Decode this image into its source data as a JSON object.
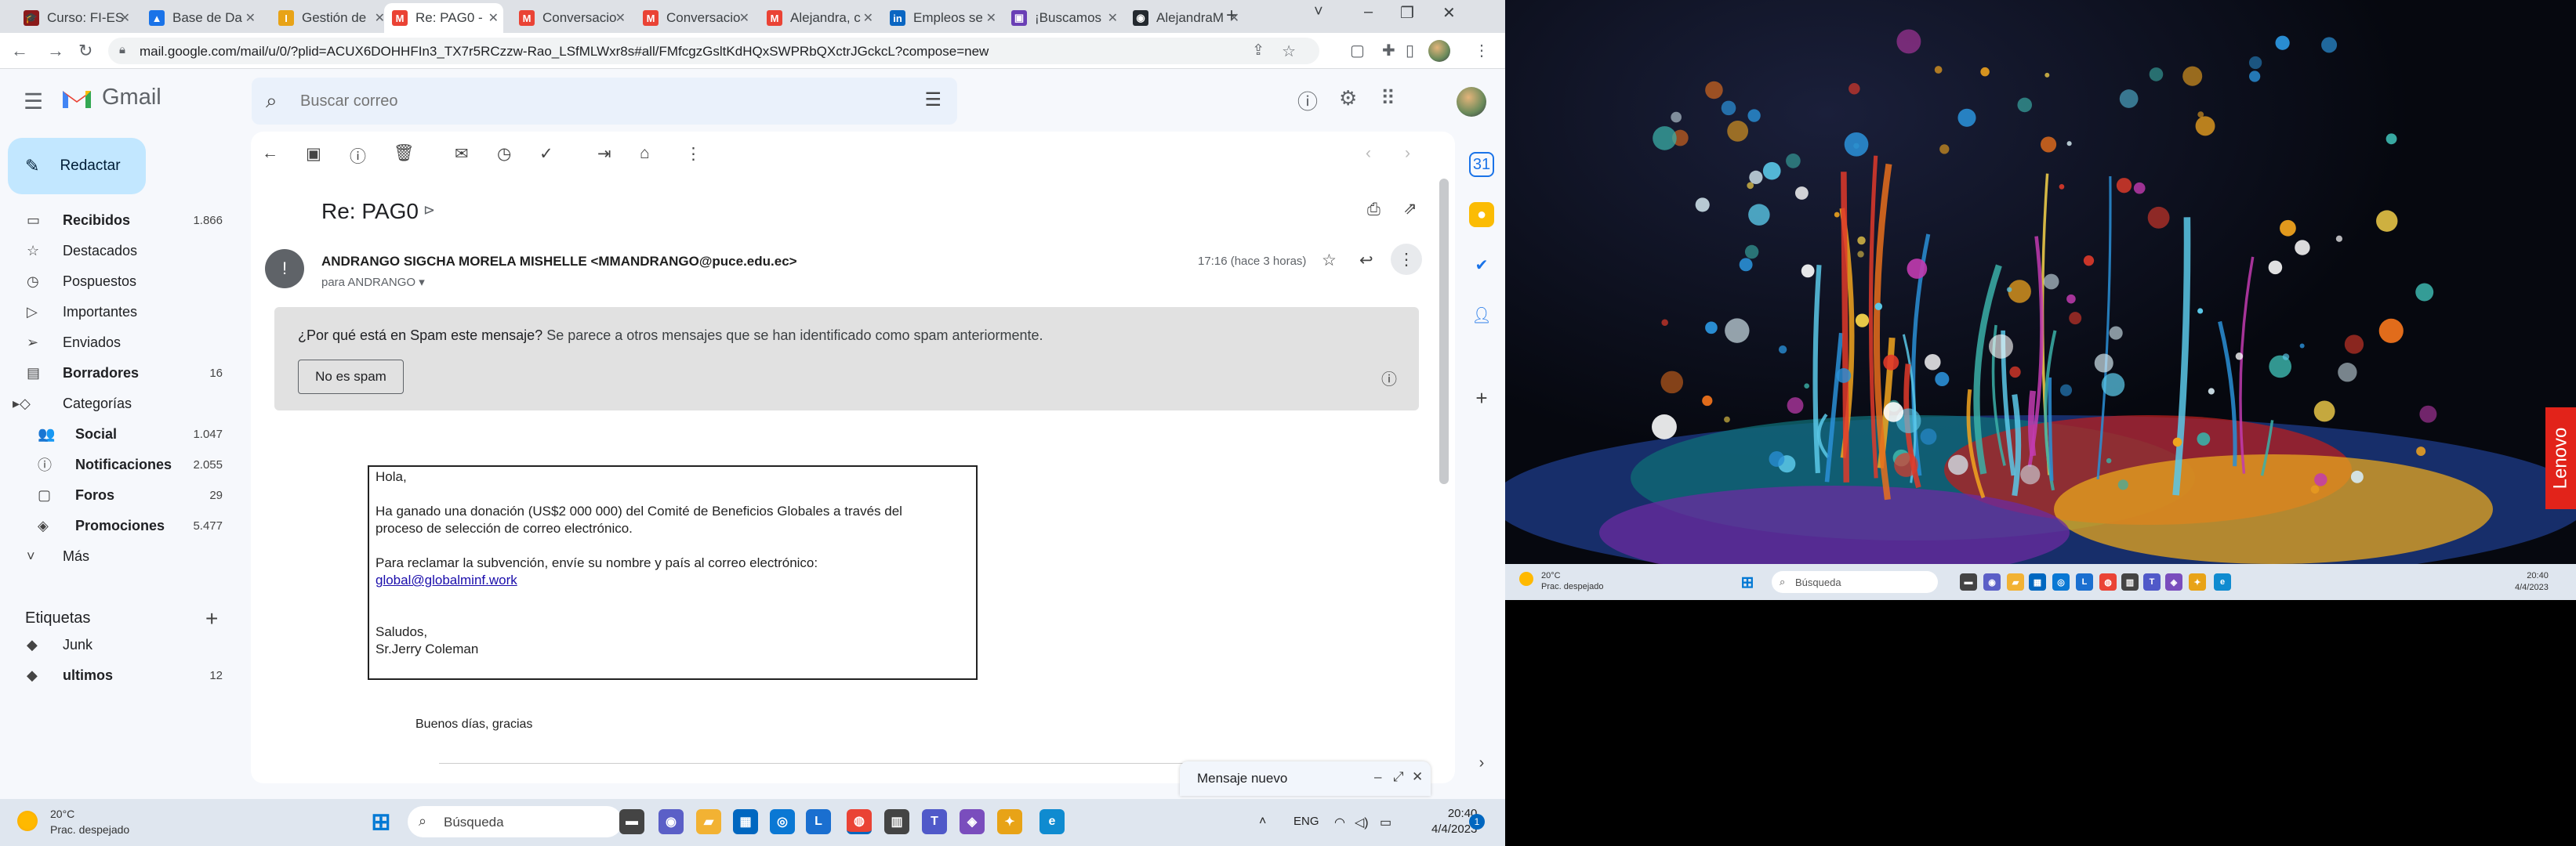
{
  "browser": {
    "tabs": [
      {
        "label": "Curso: FI-ES",
        "color": "#8b1a1a",
        "glyph": "🎓"
      },
      {
        "label": "Base de Da",
        "color": "#1a73e8",
        "glyph": "▲"
      },
      {
        "label": "Gestión de",
        "color": "#e8a317",
        "glyph": "I"
      },
      {
        "label": "Re: PAG0 -",
        "color": "#ea4335",
        "glyph": "M",
        "active": true
      },
      {
        "label": "Conversacio",
        "color": "#ea4335",
        "glyph": "M"
      },
      {
        "label": "Conversacio",
        "color": "#ea4335",
        "glyph": "M"
      },
      {
        "label": "Alejandra, c",
        "color": "#ea4335",
        "glyph": "M"
      },
      {
        "label": "Empleos se",
        "color": "#0a66c2",
        "glyph": "in"
      },
      {
        "label": "¡Buscamos",
        "color": "#6a3fb5",
        "glyph": "▣"
      },
      {
        "label": "AlejandraM",
        "color": "#24292f",
        "glyph": "◉"
      }
    ],
    "new_tab": "+",
    "url": "mail.google.com/mail/u/0/?plid=ACUX6DOHHFIn3_TX7r5RCzzw-Rao_LSfMLWxr8s#all/FMfcgzGsltKdHQxSWPRbQXctrJGckcL?compose=new"
  },
  "gmail": {
    "brand": "Gmail",
    "search_placeholder": "Buscar correo",
    "compose_label": "Redactar",
    "nav": [
      {
        "label": "Recibidos",
        "count": "1.866",
        "icon": "inbox-icon",
        "glyph": "▭",
        "bold": true
      },
      {
        "label": "Destacados",
        "count": "",
        "icon": "star-icon",
        "glyph": "☆",
        "bold": false
      },
      {
        "label": "Pospuestos",
        "count": "",
        "icon": "clock-icon",
        "glyph": "◷",
        "bold": false
      },
      {
        "label": "Importantes",
        "count": "",
        "icon": "important-icon",
        "glyph": "▷",
        "bold": false
      },
      {
        "label": "Enviados",
        "count": "",
        "icon": "send-icon",
        "glyph": "➢",
        "bold": false
      },
      {
        "label": "Borradores",
        "count": "16",
        "icon": "draft-icon",
        "glyph": "▤",
        "bold": true
      },
      {
        "label": "Categorías",
        "count": "",
        "icon": "category-icon",
        "glyph": "▸◇",
        "bold": false
      }
    ],
    "categories": [
      {
        "label": "Social",
        "count": "1.047",
        "icon": "people-icon",
        "glyph": "👥"
      },
      {
        "label": "Notificaciones",
        "count": "2.055",
        "icon": "info-icon",
        "glyph": "ⓘ"
      },
      {
        "label": "Foros",
        "count": "29",
        "icon": "forum-icon",
        "glyph": "▢"
      },
      {
        "label": "Promociones",
        "count": "5.477",
        "icon": "tag-icon",
        "glyph": "◈"
      }
    ],
    "more_label": "Más",
    "labels_heading": "Etiquetas",
    "labels": [
      {
        "label": "Junk",
        "count": "",
        "bold": false
      },
      {
        "label": "ultimos",
        "count": "12",
        "bold": true
      }
    ],
    "email": {
      "subject": "Re: PAG0",
      "sender": "ANDRANGO SIGCHA MORELA MISHELLE <MMANDRANGO@puce.edu.ec>",
      "to": "para ANDRANGO",
      "time": "17:16 (hace 3 horas)",
      "spam_question": "¿Por qué está en Spam este mensaje?",
      "spam_reason": " Se parece a otros mensajes que se han identificado como spam anteriormente.",
      "not_spam_button": "No es spam",
      "body": {
        "greeting": "Hola,",
        "line1": "Ha ganado una donación (US$2 000 000) del Comité de Beneficios Globales a través del",
        "line2": "proceso de selección de correo electrónico.",
        "line3": "Para reclamar la subvención, envíe su nombre y país al correo electrónico:",
        "link": "global@globalminf.work",
        "closing": "Saludos,",
        "signature": "Sr.Jerry Coleman"
      },
      "footnote": "Buenos días, gracias"
    },
    "new_message": "Mensaje nuevo"
  },
  "taskbar": {
    "weather_temp": "20°C",
    "weather_desc": "Prac. despejado",
    "search": "Búsqueda",
    "lang": "ENG",
    "time": "20:40",
    "date": "4/4/2023",
    "notifications": "1"
  },
  "second_screen": {
    "brand": "Lenovo",
    "weather_temp": "20°C",
    "weather_desc": "Prac. despejado",
    "search": "Búsqueda",
    "time": "20:40",
    "date": "4/4/2023"
  }
}
